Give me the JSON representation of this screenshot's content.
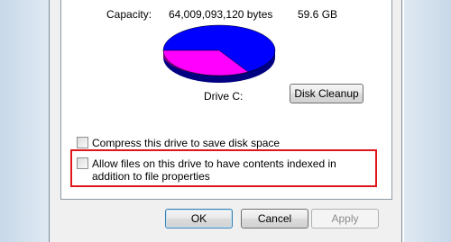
{
  "capacity": {
    "label": "Capacity:",
    "bytes": "64,009,093,120 bytes",
    "size": "59.6 GB"
  },
  "drive": {
    "label": "Drive C:",
    "used_color": "#ff00ff",
    "free_color": "#0000ff"
  },
  "disk_cleanup_button": {
    "label": "Disk Cleanup"
  },
  "options": {
    "compress": "Compress this drive to save disk space",
    "index": "Allow files on this drive to have contents indexed in addition to file properties"
  },
  "buttons": {
    "ok": "OK",
    "cancel": "Cancel",
    "apply": "Apply"
  }
}
